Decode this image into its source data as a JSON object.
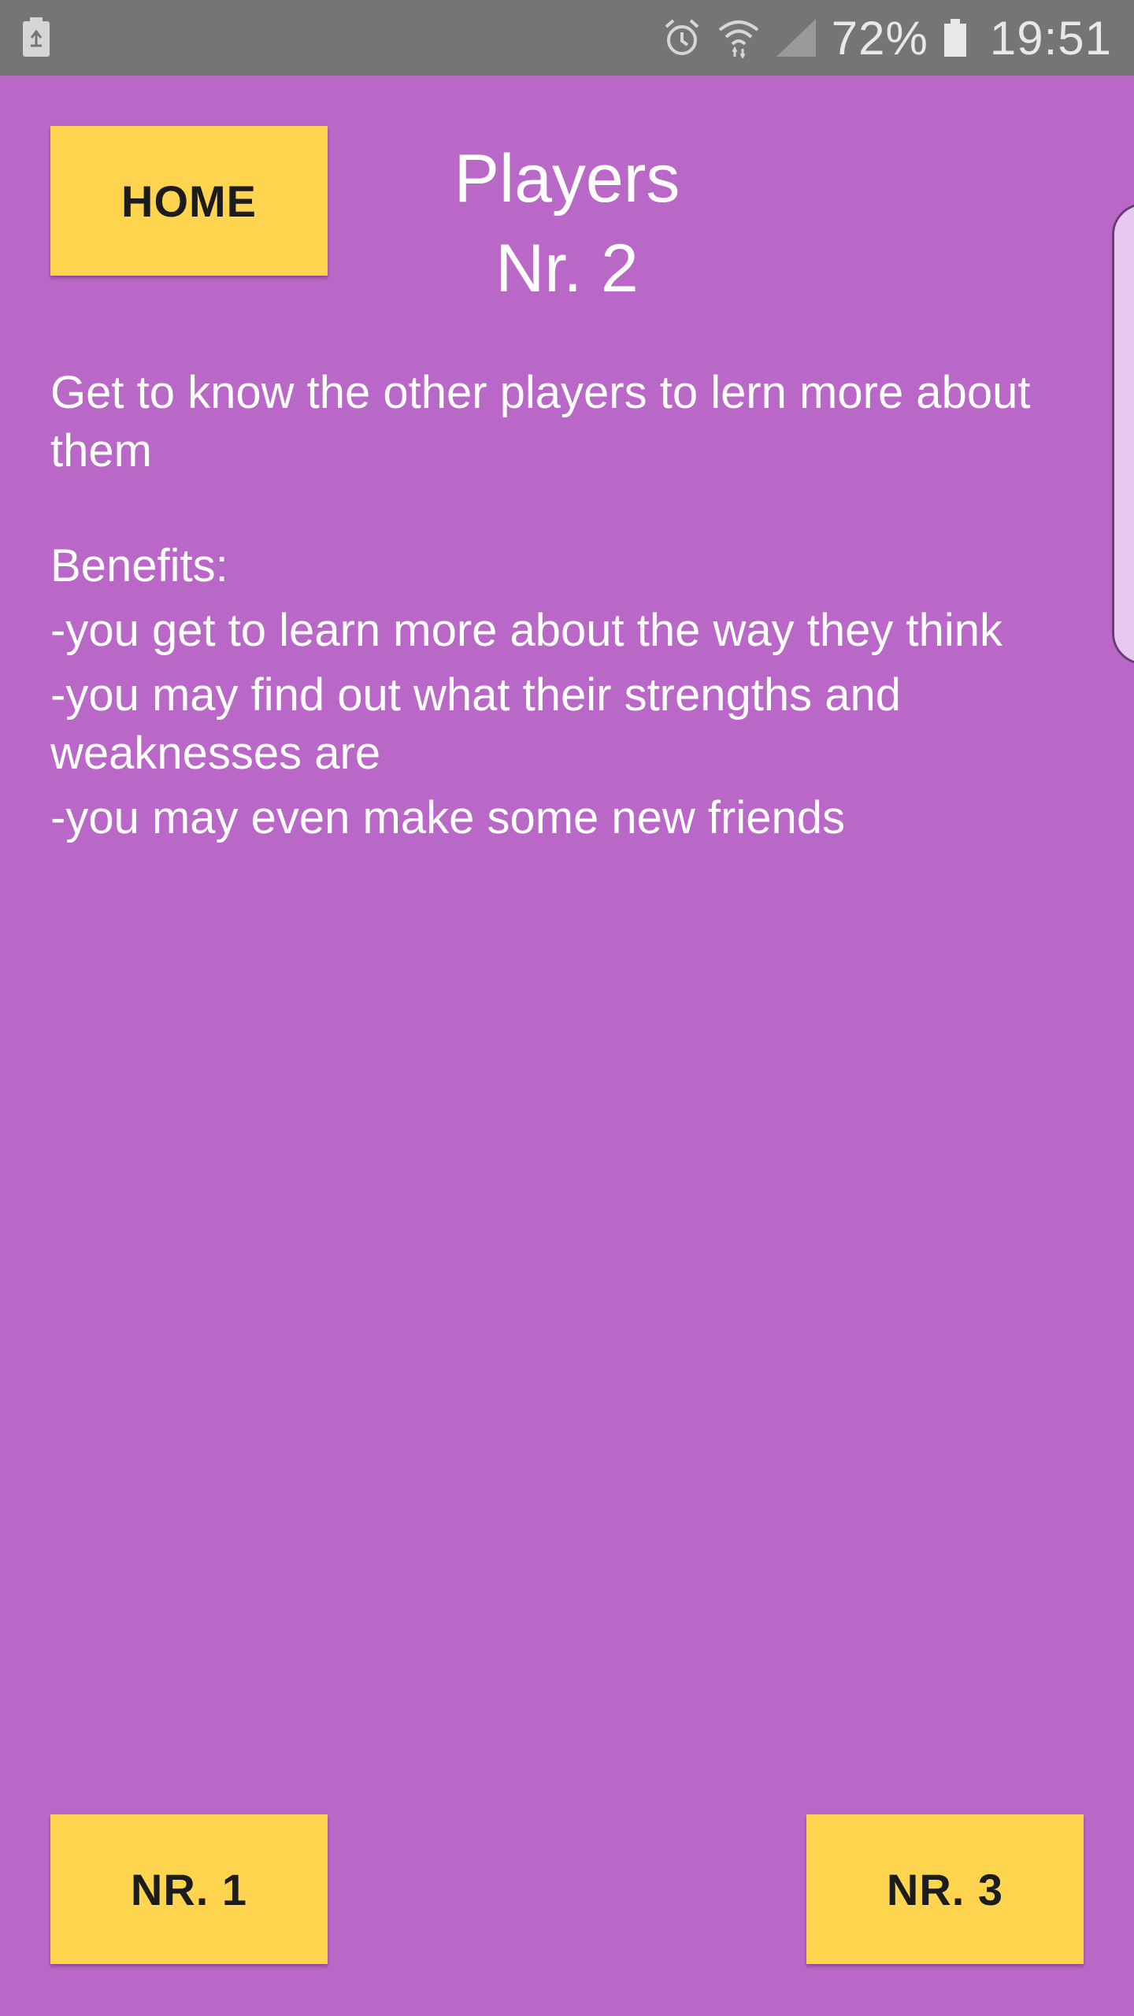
{
  "status_bar": {
    "battery_percent": "72%",
    "time": "19:51",
    "icons": [
      "battery-saver-icon",
      "alarm-icon",
      "wifi-icon",
      "signal-icon",
      "battery-icon"
    ]
  },
  "header": {
    "home_label": "HOME",
    "title_line1": "Players",
    "title_line2": "Nr. 2"
  },
  "content": {
    "intro": "Get to know the other players to lern more about them",
    "benefits_heading": "Benefits:",
    "benefits": [
      "-you get to learn more about the way they think",
      "-you may find out what their strengths and weaknesses are",
      "-you may even make some new friends"
    ]
  },
  "footer": {
    "prev_label": "NR. 1",
    "next_label": "NR. 3"
  },
  "colors": {
    "background": "#b968c7",
    "button": "#ffd54f",
    "status_bar": "#757575"
  }
}
